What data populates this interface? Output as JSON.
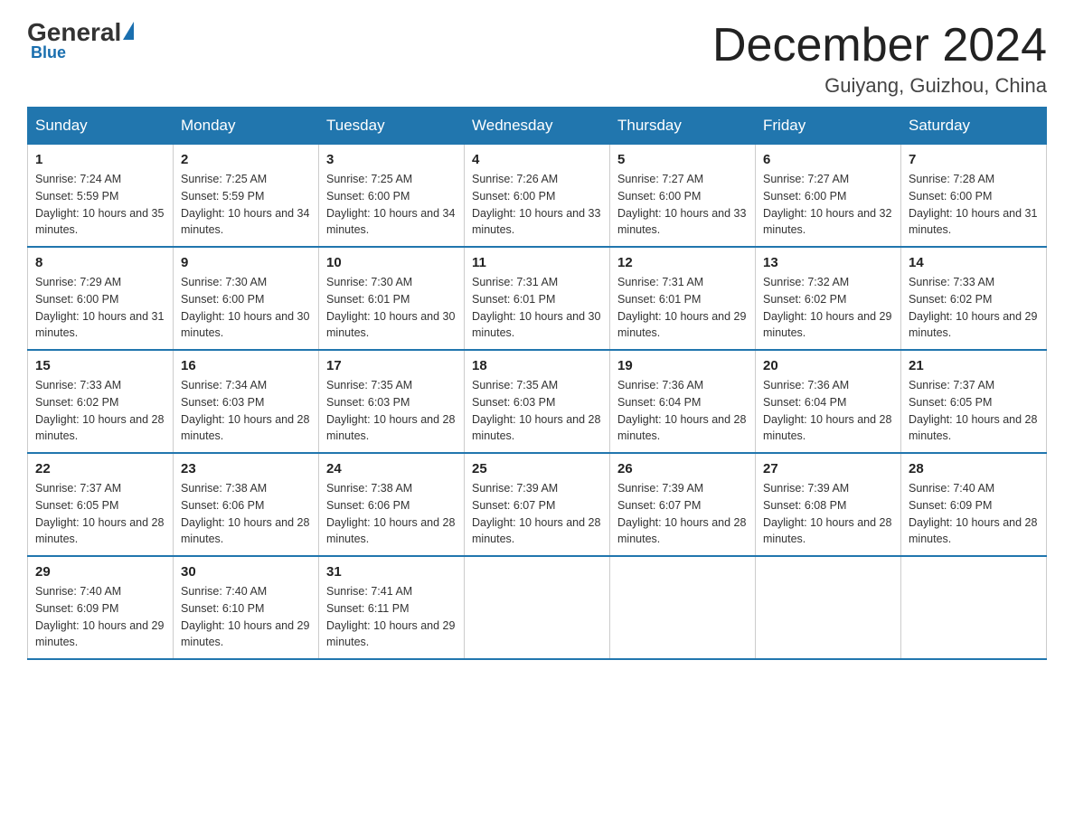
{
  "logo": {
    "general": "General",
    "blue": "Blue",
    "subtitle": "Blue"
  },
  "header": {
    "month_title": "December 2024",
    "location": "Guiyang, Guizhou, China"
  },
  "weekdays": [
    "Sunday",
    "Monday",
    "Tuesday",
    "Wednesday",
    "Thursday",
    "Friday",
    "Saturday"
  ],
  "weeks": [
    [
      {
        "day": "1",
        "sunrise": "7:24 AM",
        "sunset": "5:59 PM",
        "daylight": "10 hours and 35 minutes."
      },
      {
        "day": "2",
        "sunrise": "7:25 AM",
        "sunset": "5:59 PM",
        "daylight": "10 hours and 34 minutes."
      },
      {
        "day": "3",
        "sunrise": "7:25 AM",
        "sunset": "6:00 PM",
        "daylight": "10 hours and 34 minutes."
      },
      {
        "day": "4",
        "sunrise": "7:26 AM",
        "sunset": "6:00 PM",
        "daylight": "10 hours and 33 minutes."
      },
      {
        "day": "5",
        "sunrise": "7:27 AM",
        "sunset": "6:00 PM",
        "daylight": "10 hours and 33 minutes."
      },
      {
        "day": "6",
        "sunrise": "7:27 AM",
        "sunset": "6:00 PM",
        "daylight": "10 hours and 32 minutes."
      },
      {
        "day": "7",
        "sunrise": "7:28 AM",
        "sunset": "6:00 PM",
        "daylight": "10 hours and 31 minutes."
      }
    ],
    [
      {
        "day": "8",
        "sunrise": "7:29 AM",
        "sunset": "6:00 PM",
        "daylight": "10 hours and 31 minutes."
      },
      {
        "day": "9",
        "sunrise": "7:30 AM",
        "sunset": "6:00 PM",
        "daylight": "10 hours and 30 minutes."
      },
      {
        "day": "10",
        "sunrise": "7:30 AM",
        "sunset": "6:01 PM",
        "daylight": "10 hours and 30 minutes."
      },
      {
        "day": "11",
        "sunrise": "7:31 AM",
        "sunset": "6:01 PM",
        "daylight": "10 hours and 30 minutes."
      },
      {
        "day": "12",
        "sunrise": "7:31 AM",
        "sunset": "6:01 PM",
        "daylight": "10 hours and 29 minutes."
      },
      {
        "day": "13",
        "sunrise": "7:32 AM",
        "sunset": "6:02 PM",
        "daylight": "10 hours and 29 minutes."
      },
      {
        "day": "14",
        "sunrise": "7:33 AM",
        "sunset": "6:02 PM",
        "daylight": "10 hours and 29 minutes."
      }
    ],
    [
      {
        "day": "15",
        "sunrise": "7:33 AM",
        "sunset": "6:02 PM",
        "daylight": "10 hours and 28 minutes."
      },
      {
        "day": "16",
        "sunrise": "7:34 AM",
        "sunset": "6:03 PM",
        "daylight": "10 hours and 28 minutes."
      },
      {
        "day": "17",
        "sunrise": "7:35 AM",
        "sunset": "6:03 PM",
        "daylight": "10 hours and 28 minutes."
      },
      {
        "day": "18",
        "sunrise": "7:35 AM",
        "sunset": "6:03 PM",
        "daylight": "10 hours and 28 minutes."
      },
      {
        "day": "19",
        "sunrise": "7:36 AM",
        "sunset": "6:04 PM",
        "daylight": "10 hours and 28 minutes."
      },
      {
        "day": "20",
        "sunrise": "7:36 AM",
        "sunset": "6:04 PM",
        "daylight": "10 hours and 28 minutes."
      },
      {
        "day": "21",
        "sunrise": "7:37 AM",
        "sunset": "6:05 PM",
        "daylight": "10 hours and 28 minutes."
      }
    ],
    [
      {
        "day": "22",
        "sunrise": "7:37 AM",
        "sunset": "6:05 PM",
        "daylight": "10 hours and 28 minutes."
      },
      {
        "day": "23",
        "sunrise": "7:38 AM",
        "sunset": "6:06 PM",
        "daylight": "10 hours and 28 minutes."
      },
      {
        "day": "24",
        "sunrise": "7:38 AM",
        "sunset": "6:06 PM",
        "daylight": "10 hours and 28 minutes."
      },
      {
        "day": "25",
        "sunrise": "7:39 AM",
        "sunset": "6:07 PM",
        "daylight": "10 hours and 28 minutes."
      },
      {
        "day": "26",
        "sunrise": "7:39 AM",
        "sunset": "6:07 PM",
        "daylight": "10 hours and 28 minutes."
      },
      {
        "day": "27",
        "sunrise": "7:39 AM",
        "sunset": "6:08 PM",
        "daylight": "10 hours and 28 minutes."
      },
      {
        "day": "28",
        "sunrise": "7:40 AM",
        "sunset": "6:09 PM",
        "daylight": "10 hours and 28 minutes."
      }
    ],
    [
      {
        "day": "29",
        "sunrise": "7:40 AM",
        "sunset": "6:09 PM",
        "daylight": "10 hours and 29 minutes."
      },
      {
        "day": "30",
        "sunrise": "7:40 AM",
        "sunset": "6:10 PM",
        "daylight": "10 hours and 29 minutes."
      },
      {
        "day": "31",
        "sunrise": "7:41 AM",
        "sunset": "6:11 PM",
        "daylight": "10 hours and 29 minutes."
      },
      null,
      null,
      null,
      null
    ]
  ]
}
